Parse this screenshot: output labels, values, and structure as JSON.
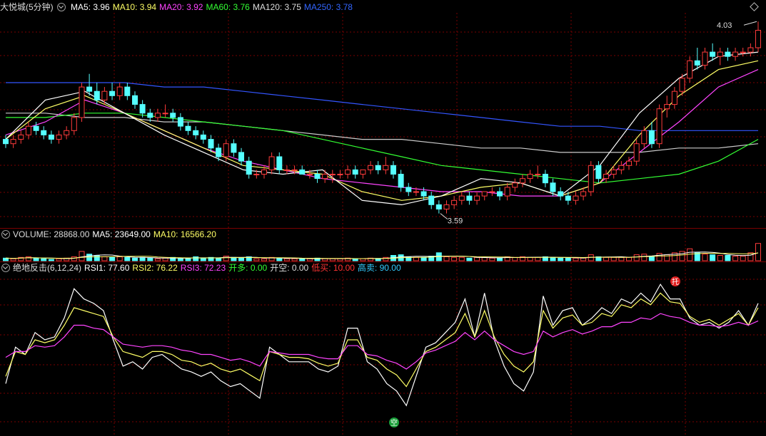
{
  "main_legend": {
    "title": "大悦城(5分钟)",
    "items": [
      {
        "label": "MA5: 3.96",
        "color": "#ffffff"
      },
      {
        "label": "MA10: 3.94",
        "color": "#ffff66"
      },
      {
        "label": "MA20: 3.92",
        "color": "#ff44ff"
      },
      {
        "label": "MA60: 3.76",
        "color": "#33ff33"
      },
      {
        "label": "MA120: 3.75",
        "color": "#dddddd"
      },
      {
        "label": "MA250: 3.78",
        "color": "#3366ff"
      }
    ]
  },
  "volume_legend": {
    "items": [
      {
        "label": "VOLUME: 28868.00",
        "color": "#dddddd"
      },
      {
        "label": "MA5: 23649.00",
        "color": "#ffffff"
      },
      {
        "label": "MA10: 16566.20",
        "color": "#ffff66"
      }
    ]
  },
  "indicator_legend": {
    "items": [
      {
        "label": "绝地反击(6,12,24)",
        "color": "#dddddd"
      },
      {
        "label": "RSI1: 77.60",
        "color": "#ffffff"
      },
      {
        "label": "RSI2: 76.22",
        "color": "#ffff66"
      },
      {
        "label": "RSI3: 72.23",
        "color": "#ff44ff"
      },
      {
        "label": "开多: 0.00",
        "color": "#33ff33"
      },
      {
        "label": "开空: 0.00",
        "color": "#dddddd"
      },
      {
        "label": "低买: 10.00",
        "color": "#ff3333"
      },
      {
        "label": "高卖: 90.00",
        "color": "#33ccff"
      }
    ]
  },
  "annotations": {
    "high_label": "4.03",
    "low_label": "3.59",
    "sell_marker": "托",
    "buy_marker": "空"
  },
  "colors": {
    "up": "#ff3b3b",
    "down": "#55ffff",
    "grid": "#7a0000",
    "ma250": "#3355ff",
    "ma120": "#cccccc",
    "ma60": "#33ff33",
    "ma20": "#ff44ff",
    "ma10": "#ffff66",
    "ma5": "#ffffff"
  },
  "chart_data": [
    {
      "type": "candlestick",
      "title": "大悦城(5分钟)",
      "ylim": [
        3.56,
        4.05
      ],
      "candles": [
        [
          3.76,
          3.77,
          3.74,
          3.75
        ],
        [
          3.75,
          3.77,
          3.74,
          3.76
        ],
        [
          3.76,
          3.78,
          3.75,
          3.77
        ],
        [
          3.77,
          3.8,
          3.76,
          3.79
        ],
        [
          3.79,
          3.8,
          3.77,
          3.78
        ],
        [
          3.78,
          3.79,
          3.76,
          3.77
        ],
        [
          3.77,
          3.78,
          3.75,
          3.76
        ],
        [
          3.76,
          3.78,
          3.75,
          3.77
        ],
        [
          3.77,
          3.79,
          3.76,
          3.78
        ],
        [
          3.78,
          3.82,
          3.77,
          3.81
        ],
        [
          3.81,
          3.89,
          3.8,
          3.88
        ],
        [
          3.88,
          3.91,
          3.86,
          3.87
        ],
        [
          3.87,
          3.89,
          3.84,
          3.85
        ],
        [
          3.85,
          3.88,
          3.84,
          3.87
        ],
        [
          3.87,
          3.89,
          3.85,
          3.86
        ],
        [
          3.86,
          3.89,
          3.85,
          3.88
        ],
        [
          3.88,
          3.89,
          3.85,
          3.86
        ],
        [
          3.86,
          3.87,
          3.83,
          3.84
        ],
        [
          3.84,
          3.85,
          3.81,
          3.82
        ],
        [
          3.82,
          3.83,
          3.8,
          3.81
        ],
        [
          3.81,
          3.83,
          3.8,
          3.82
        ],
        [
          3.82,
          3.84,
          3.81,
          3.82
        ],
        [
          3.82,
          3.83,
          3.8,
          3.81
        ],
        [
          3.81,
          3.82,
          3.78,
          3.79
        ],
        [
          3.79,
          3.8,
          3.77,
          3.78
        ],
        [
          3.78,
          3.79,
          3.76,
          3.77
        ],
        [
          3.77,
          3.78,
          3.75,
          3.76
        ],
        [
          3.76,
          3.77,
          3.73,
          3.74
        ],
        [
          3.74,
          3.75,
          3.71,
          3.72
        ],
        [
          3.72,
          3.76,
          3.71,
          3.75
        ],
        [
          3.75,
          3.76,
          3.72,
          3.73
        ],
        [
          3.73,
          3.74,
          3.7,
          3.71
        ],
        [
          3.71,
          3.72,
          3.67,
          3.68
        ],
        [
          3.68,
          3.69,
          3.67,
          3.68
        ],
        [
          3.68,
          3.7,
          3.67,
          3.69
        ],
        [
          3.69,
          3.73,
          3.68,
          3.72
        ],
        [
          3.72,
          3.73,
          3.68,
          3.69
        ],
        [
          3.69,
          3.7,
          3.68,
          3.69
        ],
        [
          3.69,
          3.7,
          3.68,
          3.69
        ],
        [
          3.69,
          3.7,
          3.68,
          3.68
        ],
        [
          3.68,
          3.69,
          3.67,
          3.68
        ],
        [
          3.68,
          3.69,
          3.66,
          3.67
        ],
        [
          3.67,
          3.69,
          3.66,
          3.68
        ],
        [
          3.68,
          3.69,
          3.66,
          3.68
        ],
        [
          3.68,
          3.69,
          3.67,
          3.68
        ],
        [
          3.68,
          3.7,
          3.67,
          3.69
        ],
        [
          3.69,
          3.7,
          3.67,
          3.68
        ],
        [
          3.68,
          3.69,
          3.67,
          3.69
        ],
        [
          3.69,
          3.71,
          3.68,
          3.7
        ],
        [
          3.7,
          3.71,
          3.68,
          3.69
        ],
        [
          3.69,
          3.72,
          3.68,
          3.7
        ],
        [
          3.7,
          3.71,
          3.67,
          3.68
        ],
        [
          3.68,
          3.69,
          3.64,
          3.65
        ],
        [
          3.65,
          3.66,
          3.63,
          3.64
        ],
        [
          3.64,
          3.65,
          3.63,
          3.64
        ],
        [
          3.64,
          3.65,
          3.62,
          3.63
        ],
        [
          3.63,
          3.64,
          3.6,
          3.61
        ],
        [
          3.61,
          3.62,
          3.59,
          3.6
        ],
        [
          3.6,
          3.62,
          3.59,
          3.61
        ],
        [
          3.61,
          3.63,
          3.6,
          3.62
        ],
        [
          3.62,
          3.64,
          3.61,
          3.63
        ],
        [
          3.63,
          3.64,
          3.61,
          3.62
        ],
        [
          3.62,
          3.64,
          3.61,
          3.63
        ],
        [
          3.63,
          3.64,
          3.62,
          3.64
        ],
        [
          3.64,
          3.65,
          3.63,
          3.64
        ],
        [
          3.64,
          3.65,
          3.62,
          3.63
        ],
        [
          3.63,
          3.66,
          3.62,
          3.65
        ],
        [
          3.65,
          3.67,
          3.64,
          3.66
        ],
        [
          3.66,
          3.68,
          3.65,
          3.67
        ],
        [
          3.67,
          3.69,
          3.66,
          3.68
        ],
        [
          3.68,
          3.7,
          3.67,
          3.68
        ],
        [
          3.68,
          3.69,
          3.65,
          3.66
        ],
        [
          3.66,
          3.67,
          3.63,
          3.64
        ],
        [
          3.64,
          3.65,
          3.62,
          3.63
        ],
        [
          3.63,
          3.64,
          3.61,
          3.62
        ],
        [
          3.62,
          3.64,
          3.61,
          3.63
        ],
        [
          3.63,
          3.65,
          3.62,
          3.64
        ],
        [
          3.64,
          3.71,
          3.63,
          3.7
        ],
        [
          3.7,
          3.71,
          3.66,
          3.67
        ],
        [
          3.67,
          3.69,
          3.66,
          3.68
        ],
        [
          3.68,
          3.7,
          3.67,
          3.69
        ],
        [
          3.69,
          3.71,
          3.68,
          3.7
        ],
        [
          3.7,
          3.72,
          3.69,
          3.71
        ],
        [
          3.71,
          3.76,
          3.7,
          3.75
        ],
        [
          3.75,
          3.79,
          3.74,
          3.78
        ],
        [
          3.78,
          3.8,
          3.74,
          3.75
        ],
        [
          3.75,
          3.84,
          3.74,
          3.83
        ],
        [
          3.83,
          3.86,
          3.81,
          3.84
        ],
        [
          3.84,
          3.88,
          3.83,
          3.87
        ],
        [
          3.87,
          3.91,
          3.86,
          3.9
        ],
        [
          3.9,
          3.95,
          3.89,
          3.94
        ],
        [
          3.94,
          3.97,
          3.92,
          3.93
        ],
        [
          3.93,
          3.97,
          3.92,
          3.96
        ],
        [
          3.96,
          3.98,
          3.94,
          3.95
        ],
        [
          3.95,
          3.97,
          3.93,
          3.96
        ],
        [
          3.96,
          3.97,
          3.94,
          3.95
        ],
        [
          3.95,
          3.97,
          3.94,
          3.96
        ],
        [
          3.96,
          3.97,
          3.95,
          3.96
        ],
        [
          3.96,
          3.98,
          3.95,
          3.97
        ],
        [
          3.97,
          4.03,
          3.96,
          4.01
        ]
      ],
      "ma250": [
        3.89,
        3.89,
        3.89,
        3.89,
        3.88,
        3.88,
        3.87,
        3.86,
        3.85,
        3.84,
        3.83,
        3.82,
        3.81,
        3.8,
        3.79,
        3.79,
        3.78,
        3.78,
        3.78,
        3.78
      ],
      "ma120": [
        3.82,
        3.82,
        3.81,
        3.81,
        3.8,
        3.8,
        3.79,
        3.78,
        3.77,
        3.76,
        3.76,
        3.75,
        3.74,
        3.74,
        3.73,
        3.73,
        3.73,
        3.74,
        3.74,
        3.75
      ],
      "ma60": [
        3.81,
        3.81,
        3.82,
        3.82,
        3.81,
        3.8,
        3.79,
        3.78,
        3.76,
        3.74,
        3.72,
        3.7,
        3.69,
        3.68,
        3.67,
        3.66,
        3.67,
        3.68,
        3.71,
        3.76
      ],
      "ma20": [
        3.77,
        3.8,
        3.85,
        3.82,
        3.78,
        3.74,
        3.71,
        3.69,
        3.67,
        3.66,
        3.65,
        3.64,
        3.64,
        3.63,
        3.63,
        3.66,
        3.73,
        3.8,
        3.88,
        3.92
      ],
      "ma10": [
        3.76,
        3.83,
        3.86,
        3.82,
        3.78,
        3.74,
        3.7,
        3.69,
        3.68,
        3.64,
        3.62,
        3.63,
        3.65,
        3.66,
        3.63,
        3.66,
        3.77,
        3.86,
        3.92,
        3.94
      ],
      "ma5": [
        3.76,
        3.85,
        3.87,
        3.82,
        3.77,
        3.73,
        3.69,
        3.68,
        3.69,
        3.62,
        3.61,
        3.63,
        3.67,
        3.66,
        3.63,
        3.7,
        3.82,
        3.9,
        3.95,
        3.96
      ]
    },
    {
      "type": "bar",
      "title": "VOLUME",
      "values": [
        4,
        3,
        5,
        6,
        4,
        3,
        2,
        3,
        4,
        6,
        14,
        10,
        8,
        6,
        5,
        6,
        5,
        4,
        5,
        4,
        3,
        4,
        5,
        4,
        3,
        6,
        4,
        5,
        4,
        7,
        5,
        4,
        6,
        3,
        3,
        5,
        4,
        3,
        3,
        3,
        3,
        4,
        3,
        3,
        3,
        4,
        3,
        3,
        4,
        3,
        5,
        8,
        9,
        6,
        5,
        5,
        7,
        12,
        6,
        5,
        5,
        4,
        5,
        5,
        4,
        4,
        6,
        5,
        6,
        5,
        5,
        6,
        5,
        4,
        4,
        4,
        4,
        9,
        6,
        5,
        5,
        5,
        5,
        9,
        10,
        7,
        11,
        9,
        12,
        14,
        18,
        12,
        10,
        9,
        8,
        8,
        7,
        7,
        12,
        26
      ],
      "ylim": [
        0,
        30
      ]
    },
    {
      "type": "line",
      "title": "绝地反击(6,12,24)",
      "ylim": [
        0,
        100
      ],
      "series": [
        {
          "name": "RSI1",
          "values": [
            30,
            55,
            50,
            65,
            60,
            62,
            75,
            95,
            88,
            85,
            80,
            60,
            42,
            45,
            40,
            48,
            50,
            45,
            40,
            38,
            35,
            38,
            32,
            28,
            30,
            25,
            20,
            55,
            50,
            45,
            45,
            45,
            40,
            38,
            42,
            68,
            68,
            45,
            40,
            30,
            25,
            15,
            35,
            55,
            58,
            65,
            72,
            88,
            62,
            92,
            60,
            42,
            30,
            25,
            38,
            90,
            70,
            80,
            82,
            70,
            75,
            82,
            78,
            88,
            85,
            92,
            86,
            98,
            88,
            88,
            75,
            70,
            72,
            68,
            72,
            80,
            70,
            85
          ]
        },
        {
          "name": "RSI2",
          "values": [
            35,
            52,
            50,
            60,
            58,
            60,
            70,
            82,
            80,
            78,
            76,
            62,
            52,
            50,
            48,
            52,
            52,
            50,
            46,
            45,
            42,
            44,
            40,
            38,
            40,
            36,
            32,
            52,
            50,
            48,
            48,
            47,
            44,
            42,
            44,
            60,
            60,
            48,
            46,
            40,
            36,
            28,
            40,
            52,
            55,
            60,
            65,
            78,
            62,
            80,
            62,
            50,
            42,
            38,
            45,
            80,
            68,
            75,
            77,
            70,
            72,
            78,
            76,
            84,
            82,
            88,
            84,
            92,
            86,
            85,
            76,
            72,
            74,
            70,
            74,
            78,
            70,
            82
          ]
        },
        {
          "name": "RSI3",
          "values": [
            48,
            52,
            52,
            56,
            55,
            56,
            62,
            70,
            70,
            68,
            67,
            62,
            57,
            56,
            55,
            56,
            56,
            55,
            53,
            52,
            50,
            50,
            48,
            46,
            47,
            45,
            42,
            52,
            51,
            50,
            50,
            50,
            48,
            47,
            47,
            56,
            56,
            50,
            49,
            46,
            44,
            40,
            45,
            51,
            53,
            56,
            59,
            65,
            60,
            66,
            60,
            56,
            52,
            50,
            52,
            66,
            62,
            65,
            67,
            64,
            66,
            69,
            69,
            72,
            72,
            75,
            74,
            78,
            76,
            75,
            72,
            70,
            70,
            69,
            70,
            72,
            70,
            73
          ]
        }
      ]
    }
  ]
}
